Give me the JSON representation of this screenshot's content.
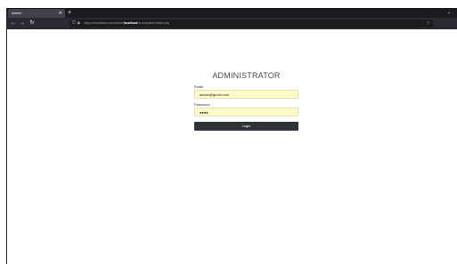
{
  "browser": {
    "tab_title": "Admin",
    "tab_close_icon": "close-icon",
    "new_tab_label": "+",
    "tab_list_icon": "chevron-down-icon",
    "url_prefix": "http://localhost/ecom/admin/",
    "url_host": "localhost",
    "url_suffix": "/ecom/admin/index.php",
    "url_display_prefix": "https://cloudflare.com/admin/",
    "url_bold": "localhost",
    "url_rest": "/ecom/admin/index.php"
  },
  "login": {
    "title": "ADMINISTRATOR",
    "email_label": "Email",
    "email_value": "admin@gmail.com",
    "password_label": "Password",
    "password_value": "●●●●",
    "button_label": "Login"
  },
  "colors": {
    "input_autofill_bg": "#fffbc8",
    "button_bg": "#2f3238",
    "browser_chrome": "#1c1b22"
  }
}
